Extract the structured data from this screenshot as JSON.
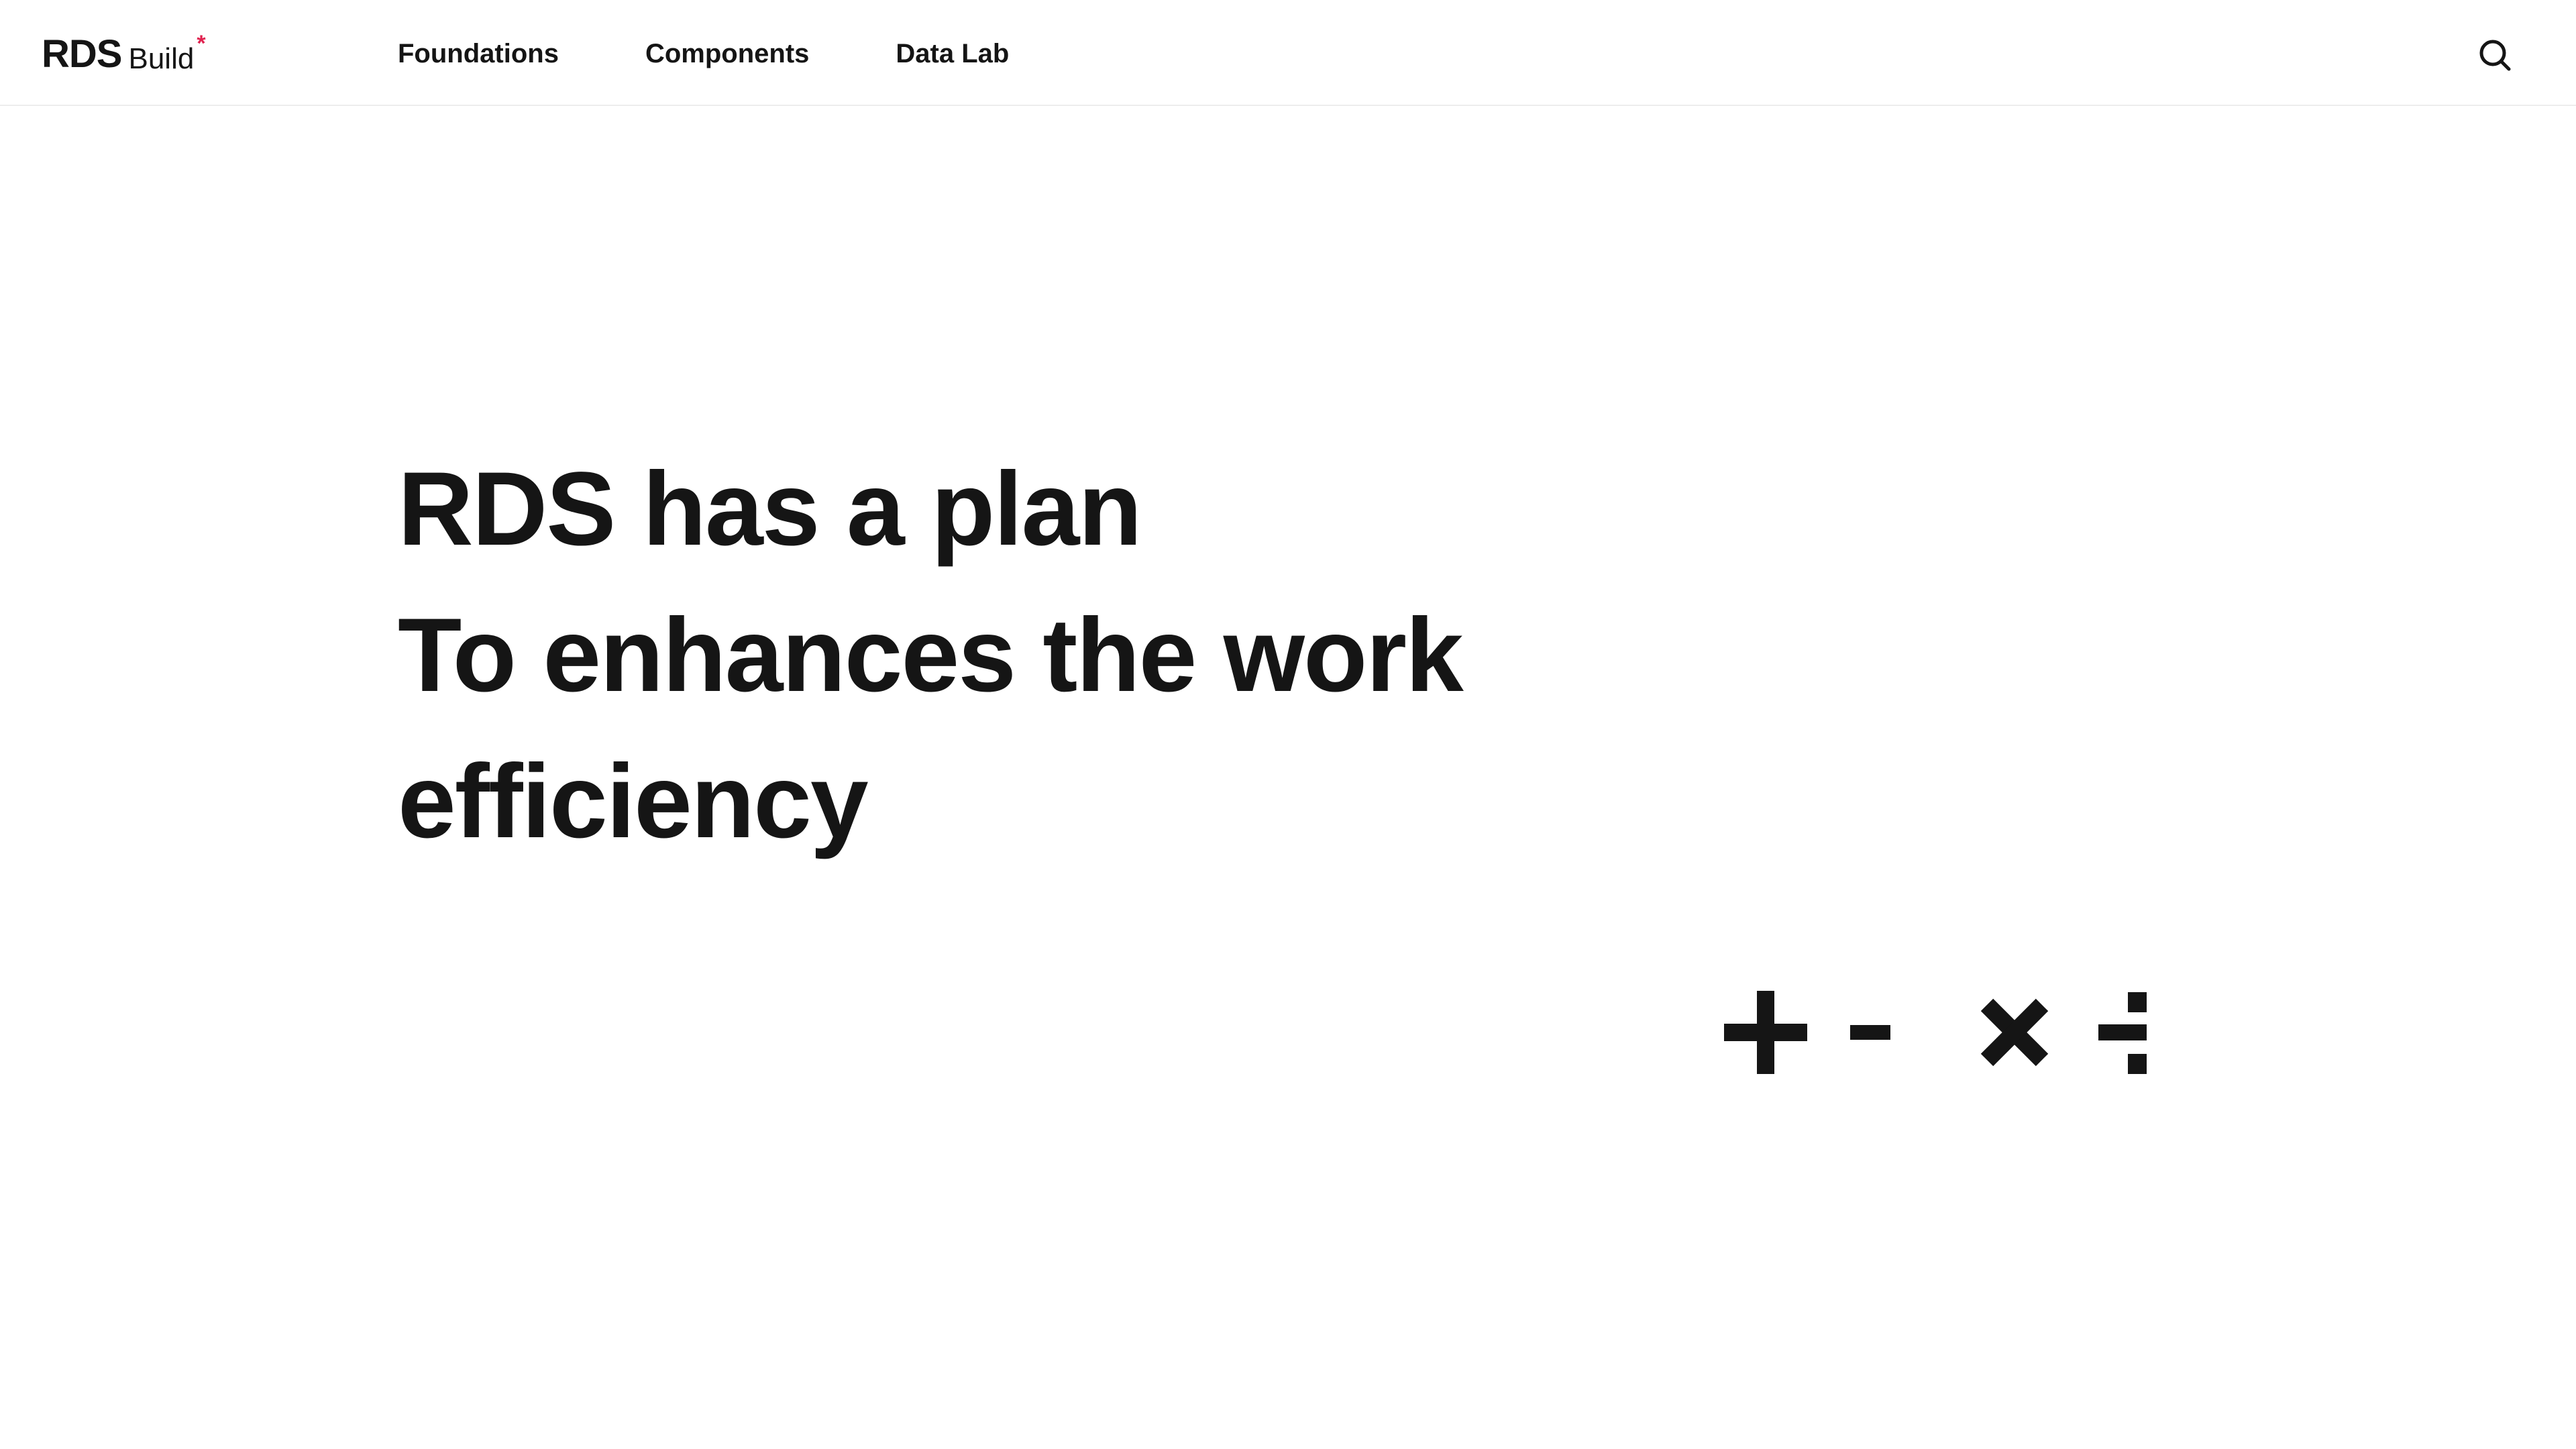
{
  "header": {
    "logo": {
      "main": "RDS",
      "sub": "Build",
      "mark": "*"
    },
    "nav": [
      "Foundations",
      "Components",
      "Data Lab"
    ],
    "search_icon": "search-icon"
  },
  "hero": {
    "lines": [
      "RDS has a plan",
      "To enhances the work",
      "efficiency"
    ]
  },
  "decoration": {
    "icons": [
      "plus-icon",
      "minus-icon",
      "times-icon",
      "divide-icon"
    ]
  },
  "colors": {
    "text": "#151515",
    "accent": "#e0224f",
    "background": "#ffffff"
  }
}
